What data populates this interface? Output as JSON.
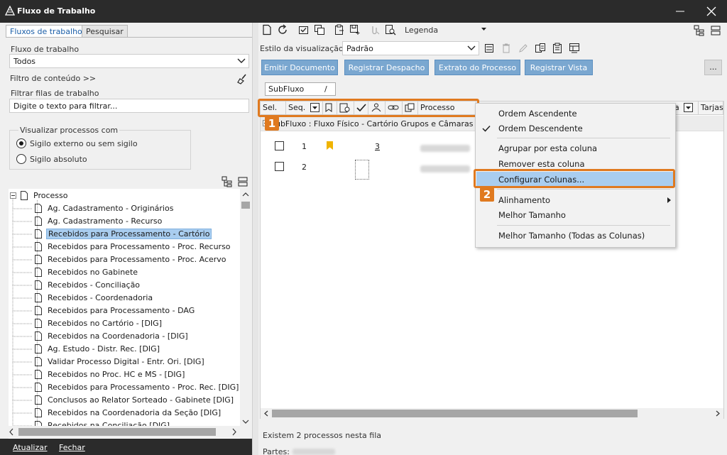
{
  "window": {
    "title": "Fluxo de Trabalho"
  },
  "left": {
    "tabs": [
      "Fluxos de trabalho",
      "Pesquisar"
    ],
    "fluxo_label": "Fluxo de trabalho",
    "fluxo_value": "Todos",
    "filtro_conteudo": "Filtro de conteúdo >>",
    "filtrar_filas_label": "Filtrar filas de trabalho",
    "filtrar_placeholder": "Digite o texto para filtrar...",
    "visualizar_label": "Visualizar processos com",
    "radio1": "Sigilo externo ou sem sigilo",
    "radio2": "Sigilo absoluto",
    "tree_root": "Processo",
    "tree_items": [
      "Ag. Cadastramento - Originários",
      "Ag. Cadastramento - Recurso",
      "Recebidos para Processamento - Cartório",
      "Recebidos para Processamento - Proc. Recurso",
      "Recebidos para Processamento - Proc. Acervo",
      "Recebidos no Gabinete",
      "Recebidos - Conciliação",
      "Recebidos - Coordenadoria",
      "Recebidos para Processamento - DAG",
      "Recebidos no Cartório - [DIG]",
      "Recebidos na Coordenadoria - [DIG]",
      "Ag. Estudo - Distr. Rec. [DIG]",
      "Validar Processo Digital - Entr. Ori. [DIG]",
      "Recebidos no Proc. HC e MS - [DIG]",
      "Recebidos para Processamento - Proc. Rec. [DIG]",
      "Conclusos ao Relator Sorteado - Gabinete [DIG]",
      "Recebidos na Coordenadoria da Seção [DIG]",
      "Recebidos na Conciliação [DIG]"
    ],
    "footer_atualizar": "Atualizar",
    "footer_fechar": "Fechar"
  },
  "right": {
    "legenda": "Legenda",
    "estilo_label": "Estilo da visualização",
    "estilo_value": "Padrão",
    "buttons": [
      "Emitir Documento",
      "Registrar Despacho",
      "Extrato do Processo",
      "Registrar Vista"
    ],
    "more_button": "...",
    "subfluxo_tag": "SubFluxo",
    "subfluxo_tag_sort": "/",
    "columns": {
      "sel": "Sel.",
      "seq": "Seq.",
      "processo": "Processo",
      "col_a": "a",
      "tarjas": "Tarjas"
    },
    "group_row": "SubFluxo : Fluxo Físico - Cartório Grupos e Câmaras - Pr",
    "rows": [
      {
        "seq": "1",
        "count": "3"
      },
      {
        "seq": "2",
        "count": ""
      }
    ],
    "status": "Existem 2 processos nesta fila",
    "partes_label": "Partes:"
  },
  "context_menu": {
    "items": [
      "Ordem Ascendente",
      "Ordem Descendente",
      "Agrupar por esta coluna",
      "Remover esta coluna",
      "Configurar Colunas...",
      "Alinhamento",
      "Melhor Tamanho",
      "Melhor Tamanho (Todas as Colunas)"
    ]
  },
  "badges": [
    "1",
    "2"
  ],
  "colors": {
    "accent_orange": "#e07a20",
    "button_blue": "#7aa7d0",
    "selection": "#a9cdef",
    "titlebar": "#2b2b2b"
  }
}
